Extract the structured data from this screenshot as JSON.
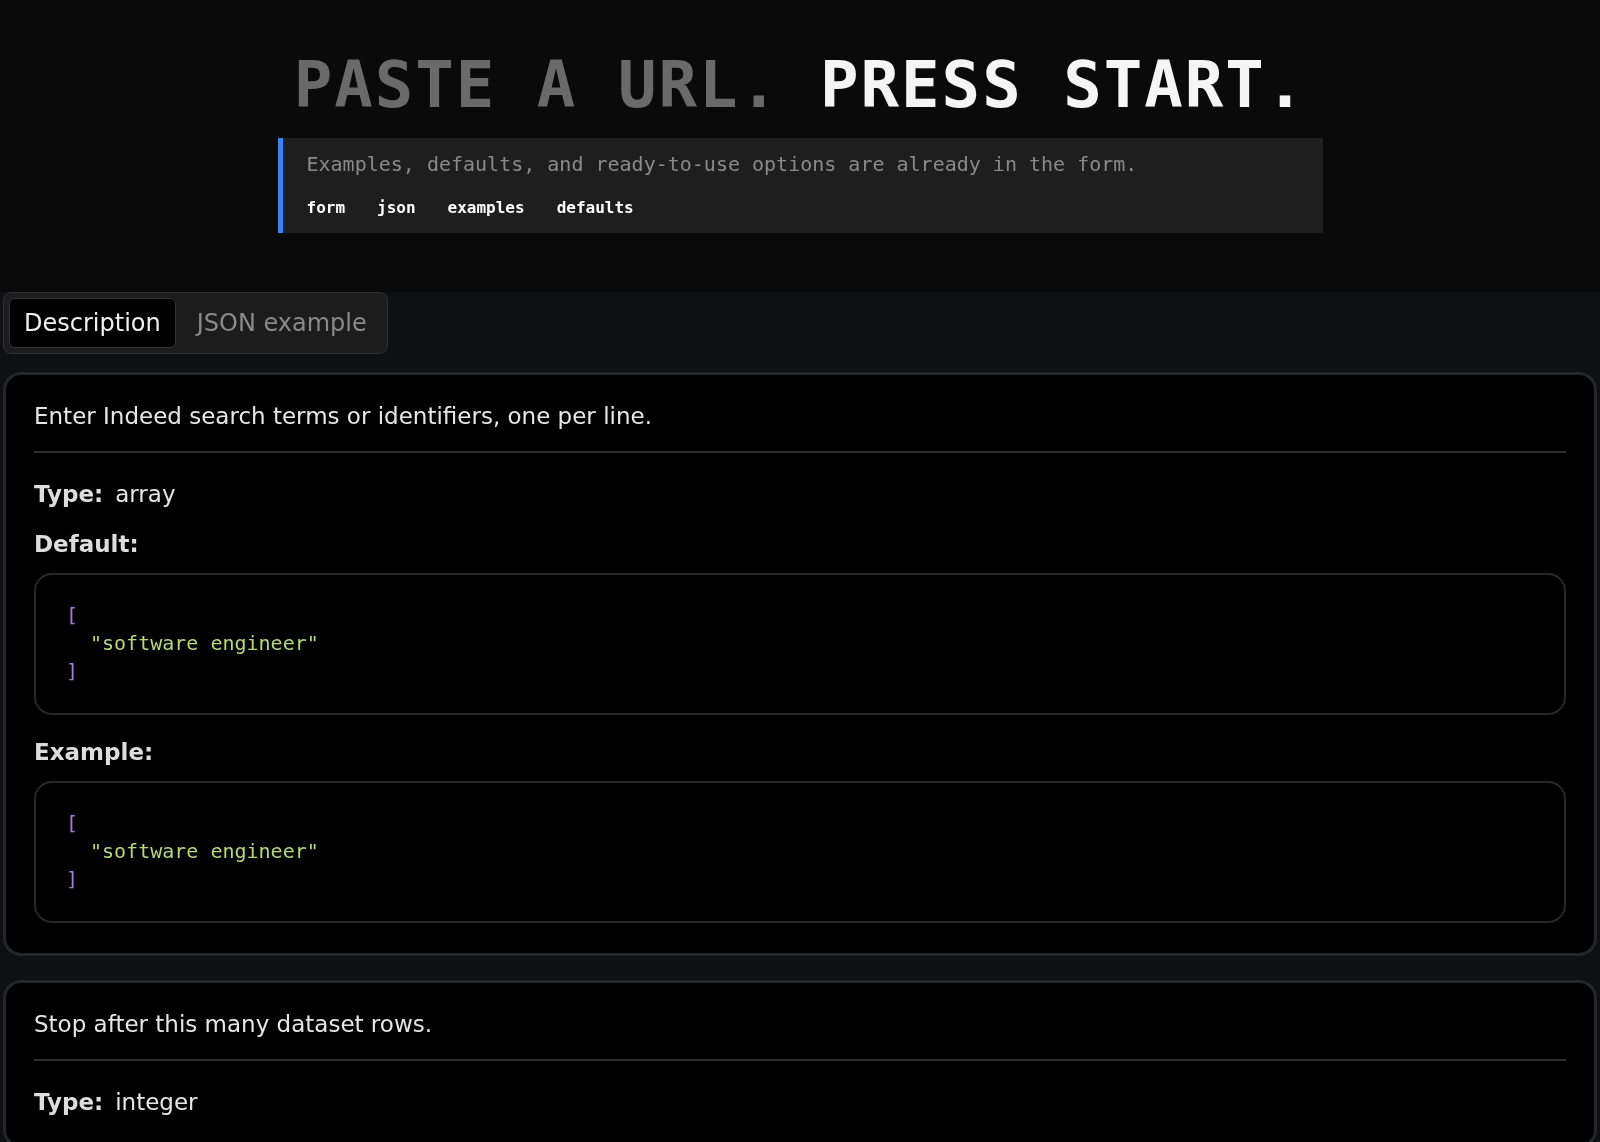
{
  "headline": {
    "muted": "PASTE A URL.",
    "bright": "PRESS START."
  },
  "callout": {
    "text": "Examples, defaults, and ready-to-use options are already in the form.",
    "tags": [
      "form",
      "json",
      "examples",
      "defaults"
    ]
  },
  "tabs": [
    {
      "label": "Description",
      "selected": true
    },
    {
      "label": "JSON example",
      "selected": false
    }
  ],
  "fields": [
    {
      "description": "Enter Indeed search terms or identifiers, one per line.",
      "type_label": "Type:",
      "type": "array",
      "blocks": [
        {
          "label": "Default:",
          "lines": [
            {
              "kind": "bracket",
              "text": "["
            },
            {
              "kind": "string",
              "text": "\"software engineer\""
            },
            {
              "kind": "bracket",
              "text": "]"
            }
          ]
        },
        {
          "label": "Example:",
          "lines": [
            {
              "kind": "bracket",
              "text": "["
            },
            {
              "kind": "string",
              "text": "\"software engineer\""
            },
            {
              "kind": "bracket",
              "text": "]"
            }
          ]
        }
      ]
    },
    {
      "description": "Stop after this many dataset rows.",
      "type_label": "Type:",
      "type": "integer"
    }
  ]
}
